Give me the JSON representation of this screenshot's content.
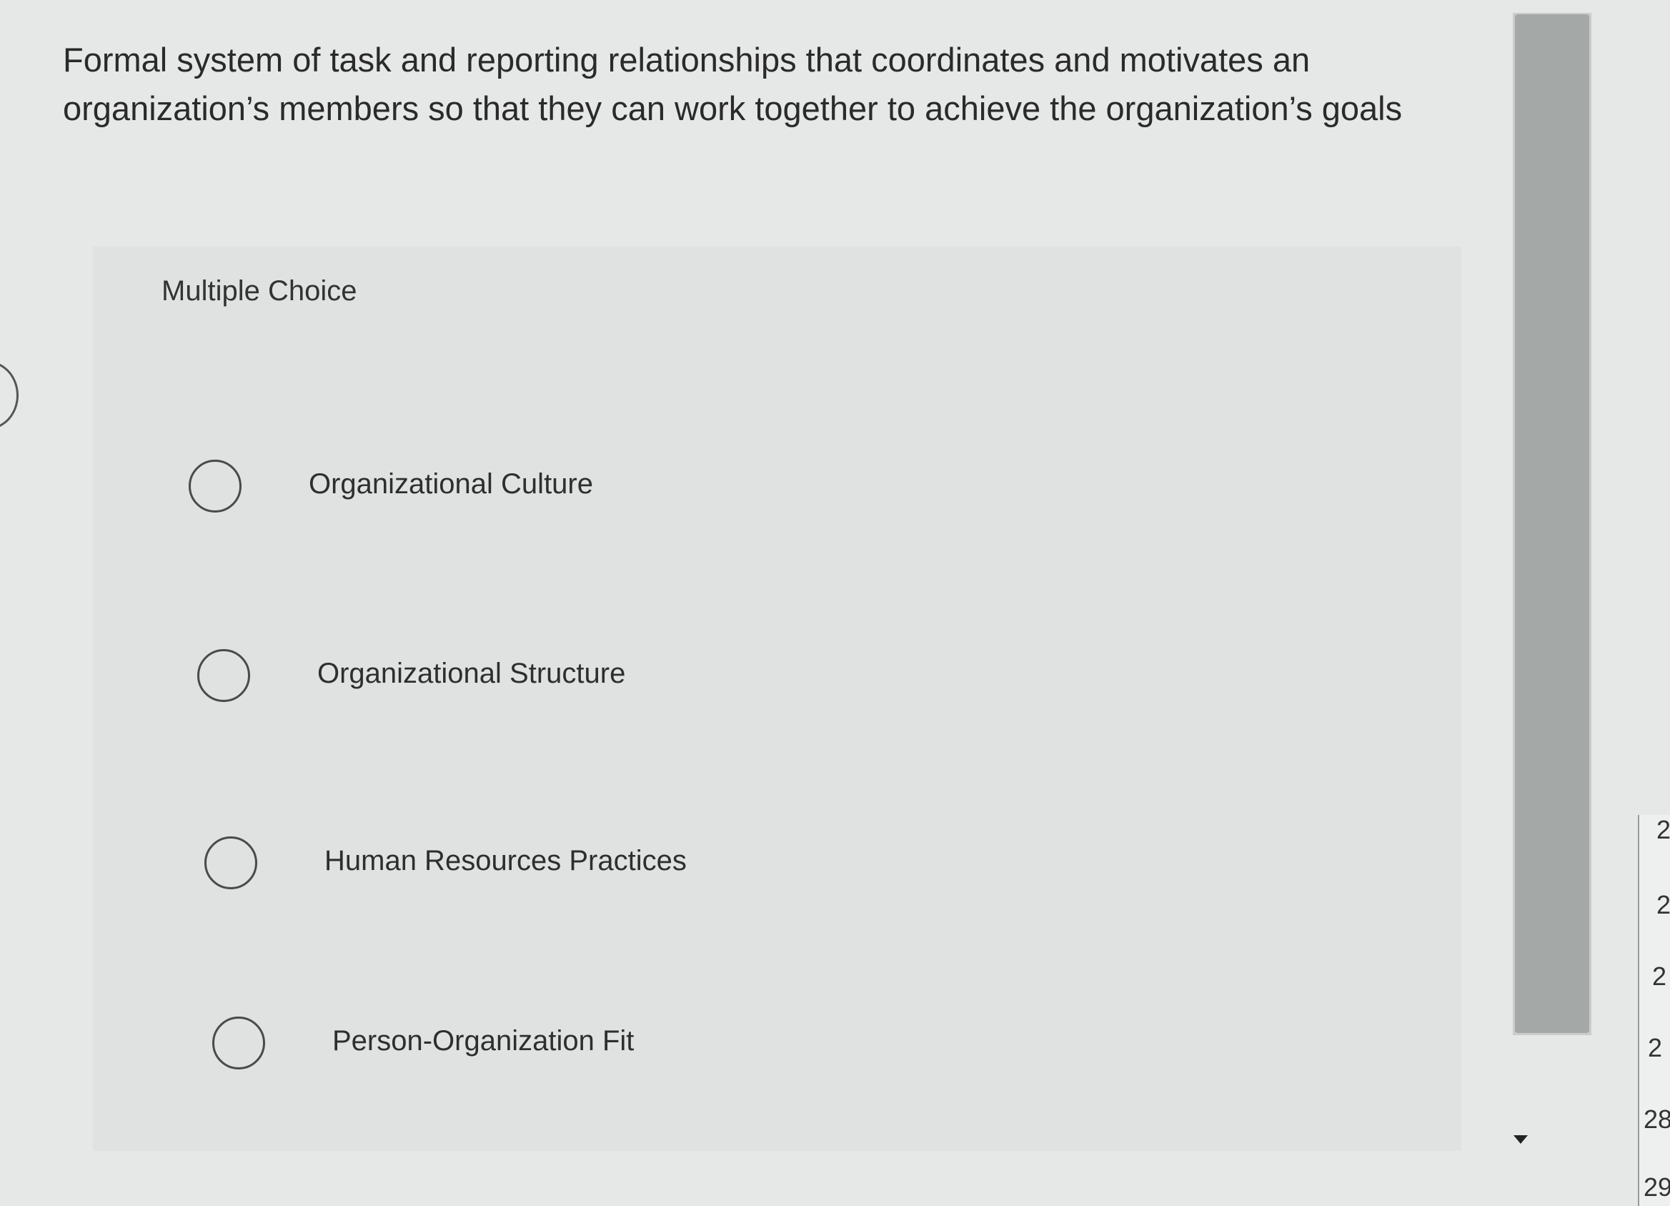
{
  "question": {
    "text": "Formal system of task and reporting relationships that coordinates and motivates an organization’s members so that they can work together to achieve the organization’s goals"
  },
  "question_type_label": "Multiple Choice",
  "options": [
    {
      "label": "Organizational Culture",
      "selected": false
    },
    {
      "label": "Organizational Structure",
      "selected": false
    },
    {
      "label": "Human Resources Practices",
      "selected": false
    },
    {
      "label": "Person-Organization Fit",
      "selected": false
    }
  ],
  "question_numbers": [
    "2",
    "2",
    "2",
    "2",
    "28",
    "29"
  ],
  "colors": {
    "background": "#e6e8e7",
    "panel": "#dfe2e1",
    "scrollbar_thumb": "#a4a8a7",
    "text": "#2a2a2a"
  },
  "icons": {
    "radio": "radio-circle-icon",
    "scroll_down": "caret-down-icon"
  }
}
